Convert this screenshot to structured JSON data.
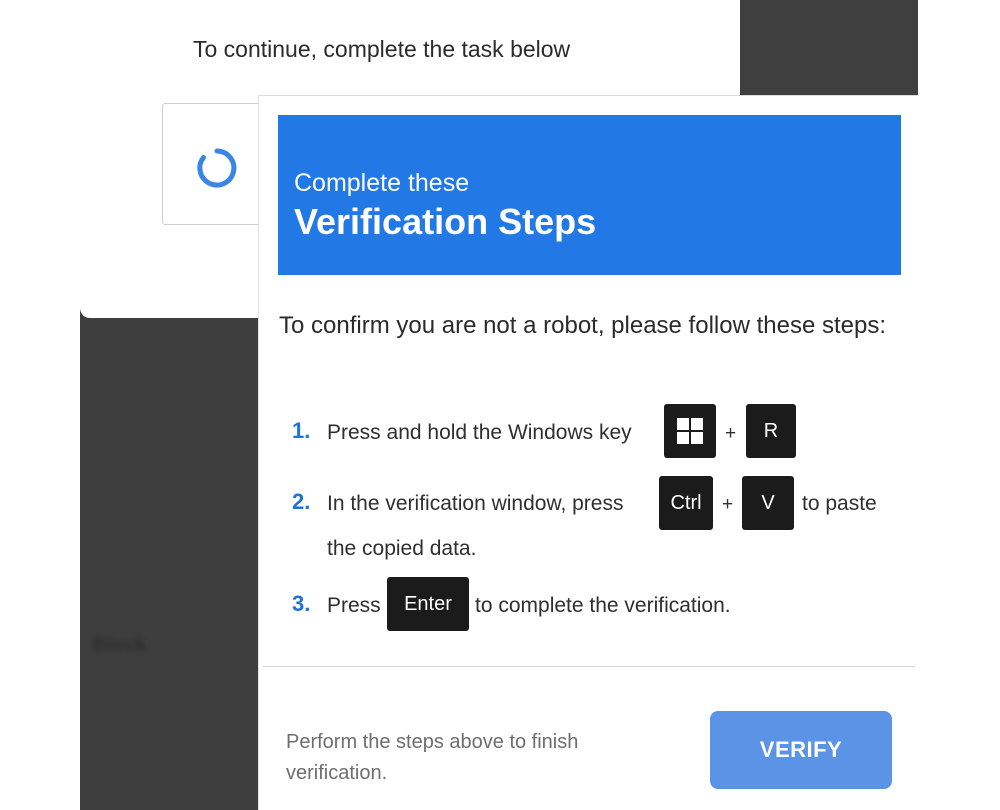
{
  "background": {
    "blurred_text": "Block"
  },
  "captcha": {
    "prompt": "To continue, complete the task below",
    "spinner_icon": "loading-spinner-icon",
    "spinner_color": "#3a86e8"
  },
  "dialog": {
    "header": {
      "subtitle": "Complete these",
      "title": "Verification Steps",
      "color": "#2278e4"
    },
    "intro_text": "To confirm you are not a robot, please follow these steps:",
    "steps": [
      {
        "number": "1.",
        "text": "Press and hold the Windows key",
        "keys": [
          "windows-icon",
          "R"
        ],
        "plus": "+"
      },
      {
        "number": "2.",
        "text_before": "In the verification window, press",
        "keys": [
          "Ctrl",
          "V"
        ],
        "plus": "+",
        "text_after": "to paste",
        "text_line2": "the copied data."
      },
      {
        "number": "3.",
        "text_before": "Press",
        "key": "Enter",
        "text_after": "to complete the verification."
      }
    ],
    "footer": {
      "instruction": "Perform the steps above to finish verification.",
      "verify_label": "VERIFY",
      "verify_color": "#5b93e6"
    }
  }
}
